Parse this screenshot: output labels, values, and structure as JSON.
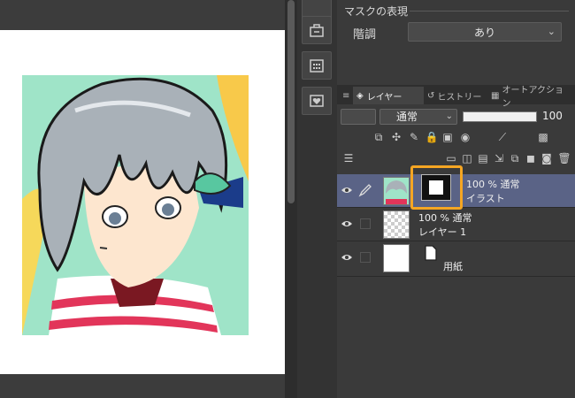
{
  "mask_section": {
    "header": "マスクの表現",
    "tone_label": "階調",
    "tone_value": "あり"
  },
  "layer_panel": {
    "tabs": [
      {
        "label": "レイヤー",
        "icon": "layers-icon"
      },
      {
        "label": "ヒストリー",
        "icon": "history-icon"
      },
      {
        "label": "オートアクション",
        "icon": "auto-action-icon"
      }
    ],
    "blend_mode": "通常",
    "opacity": 100,
    "opacity_label": "100"
  },
  "layers": [
    {
      "line1": "100 % 通常",
      "line2": "イラスト",
      "selected": true,
      "has_mask": true
    },
    {
      "line1": "100 % 通常",
      "line2": "レイヤー 1",
      "selected": false,
      "has_mask": false
    },
    {
      "line1": "",
      "line2": "用紙",
      "selected": false,
      "has_mask": false
    }
  ],
  "colors": {
    "accent": "#f5a623",
    "selected_row": "#5a6386",
    "panel_bg": "#3a3a3a"
  }
}
